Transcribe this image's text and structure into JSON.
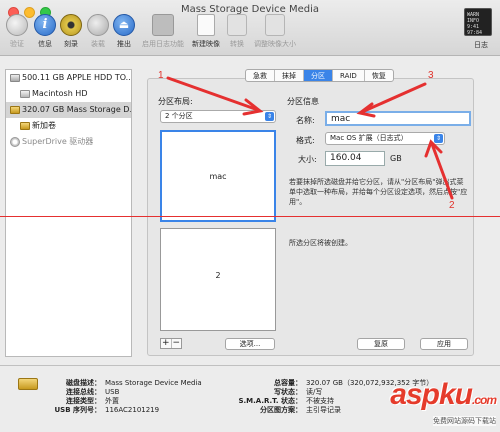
{
  "window": {
    "title": "Mass Storage Device Media"
  },
  "toolbar": {
    "items": [
      {
        "label": "验证",
        "enabled": false
      },
      {
        "label": "信息",
        "enabled": true
      },
      {
        "label": "刻录",
        "enabled": true
      },
      {
        "label": "装载",
        "enabled": false
      },
      {
        "label": "推出",
        "enabled": true
      },
      {
        "label": "启用日志功能",
        "enabled": false
      },
      {
        "label": "新建映像",
        "enabled": true
      },
      {
        "label": "转换",
        "enabled": false
      },
      {
        "label": "调整映像大小",
        "enabled": false
      }
    ],
    "log_label": "日志",
    "log_box_lines": [
      "WARN",
      "INFO",
      "9:41",
      "97:84"
    ]
  },
  "sidebar": {
    "items": [
      {
        "label": "500.11 GB APPLE HDD TO..",
        "type": "hdd"
      },
      {
        "label": "Macintosh HD",
        "type": "volume"
      },
      {
        "label": "320.07 GB Mass Storage D..",
        "type": "external",
        "selected": true
      },
      {
        "label": "新加卷",
        "type": "volume-external"
      },
      {
        "label": "SuperDrive 驱动器",
        "type": "dvd",
        "dimmed": true
      }
    ]
  },
  "tabs": [
    "急救",
    "抹掉",
    "分区",
    "RAID",
    "恢复"
  ],
  "active_tab": "分区",
  "partition": {
    "layout_heading": "分区布局:",
    "layout_value": "2 个分区",
    "partitions": [
      "mac",
      "2"
    ],
    "info_heading": "分区信息",
    "name_label": "名称:",
    "name_value": "mac",
    "format_label": "格式:",
    "format_value": "Mac OS 扩展（日志式）",
    "size_label": "大小:",
    "size_value": "160.04",
    "size_unit": "GB",
    "help_text": "若要抹掉所选磁盘并给它分区，请从\"分区布局\"弹出式菜单中选取一种布局，并给每个分区设定选项，然后点按\"应用\"。",
    "status_text": "所选分区将被创建。",
    "options_button": "选项...",
    "revert_button": "复原",
    "apply_button": "应用"
  },
  "footer": {
    "left": [
      {
        "key": "磁盘描述：",
        "value": "Mass Storage Device Media"
      },
      {
        "key": "连接总线：",
        "value": "USB"
      },
      {
        "key": "连接类型：",
        "value": "外置"
      },
      {
        "key": "USB 序列号：",
        "value": "116AC2101219"
      }
    ],
    "right": [
      {
        "key": "总容量：",
        "value": "320.07 GB（320,072,932,352 字节）"
      },
      {
        "key": "写状态：",
        "value": "读/写"
      },
      {
        "key": "S.M.A.R.T. 状态：",
        "value": "不被支持"
      },
      {
        "key": "分区图方案：",
        "value": "主引导记录"
      }
    ]
  },
  "annotations": [
    "1",
    "2",
    "3"
  ],
  "watermark": {
    "brand": "aspku",
    "tld": ".com",
    "subtitle": "免费网站源码下载站"
  }
}
